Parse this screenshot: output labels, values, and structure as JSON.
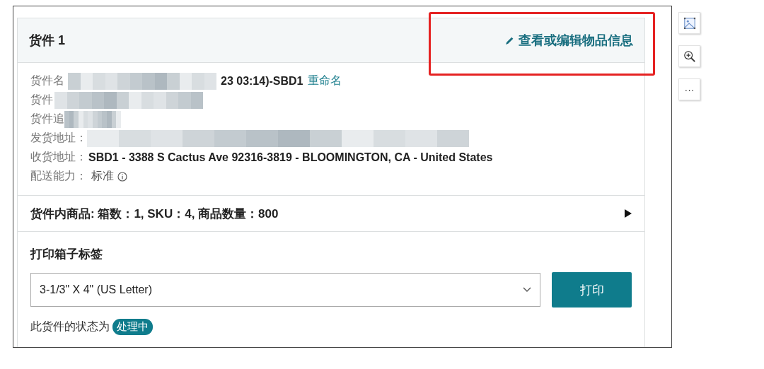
{
  "shipment": {
    "title": "货件 1",
    "edit_link": "查看或编辑物品信息",
    "details": [
      {
        "label": "货件名",
        "obscured": true,
        "value": "23 03:14)-SBD1",
        "link": "重命名"
      },
      {
        "label": "货件",
        "obscured": true
      },
      {
        "label": "货件追",
        "obscured": true
      },
      {
        "label": "发货地址：",
        "obscured": true
      },
      {
        "label": "收货地址：",
        "obscured": false,
        "value": "SBD1 - 3388 S Cactus Ave 92316-3819 - BLOOMINGTON, CA - United States"
      },
      {
        "label": "配送能力：",
        "obscured": false,
        "value": "标准",
        "info": true
      }
    ],
    "contents_summary": "货件内商品: 箱数：1, SKU：4, 商品数量：800",
    "print": {
      "title": "打印箱子标签",
      "label_size": "3-1/3\" X 4\" (US Letter)",
      "button": "打印"
    },
    "status": {
      "text": "此货件的状态为",
      "badge": "处理中"
    }
  },
  "highlight": true,
  "side_toolbar": [
    {
      "kind": "image"
    },
    {
      "kind": "zoom"
    },
    {
      "kind": "more",
      "label": "···"
    }
  ]
}
